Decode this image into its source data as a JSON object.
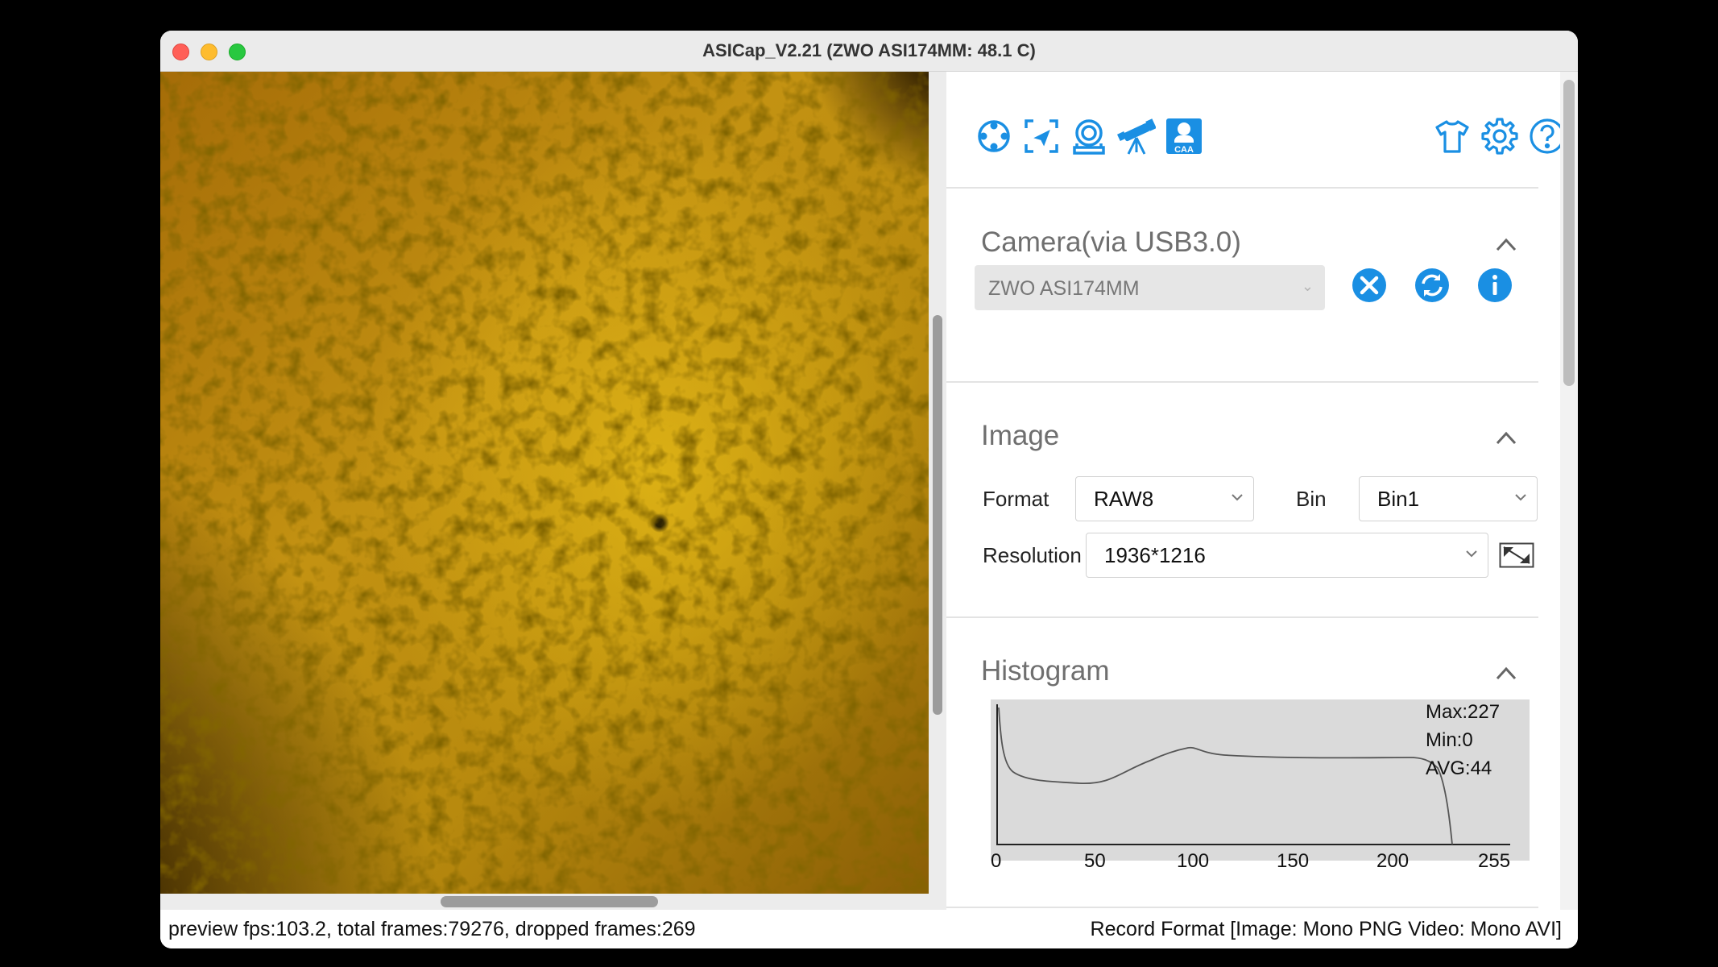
{
  "window": {
    "title": "ASICap_V2.21 (ZWO ASI174MM: 48.1 C)"
  },
  "toolbar": {
    "left_icons": [
      "focus-target-icon",
      "roi-select-icon",
      "camera-mount-icon",
      "telescope-icon",
      "caa-icon"
    ],
    "caa_label": "CAA",
    "right_icons": [
      "shirt-icon",
      "gear-icon",
      "help-icon"
    ]
  },
  "camera": {
    "title": "Camera(via USB3.0)",
    "selected": "ZWO ASI174MM",
    "buttons": [
      "disconnect-icon",
      "refresh-icon",
      "info-icon"
    ]
  },
  "image": {
    "title": "Image",
    "format_label": "Format",
    "format_value": "RAW8",
    "bin_label": "Bin",
    "bin_value": "Bin1",
    "resolution_label": "Resolution",
    "resolution_value": "1936*1216"
  },
  "histogram": {
    "title": "Histogram",
    "max": "Max:227",
    "min": "Min:0",
    "avg": "AVG:44",
    "ticks": [
      "0",
      "50",
      "100",
      "150",
      "200",
      "255"
    ]
  },
  "status": {
    "left": "preview fps:103.2, total frames:79276, dropped frames:269",
    "right": "Record Format [Image: Mono PNG Video: Mono AVI]"
  },
  "colors": {
    "accent": "#1a8fe3",
    "sun": "#b8860b"
  }
}
